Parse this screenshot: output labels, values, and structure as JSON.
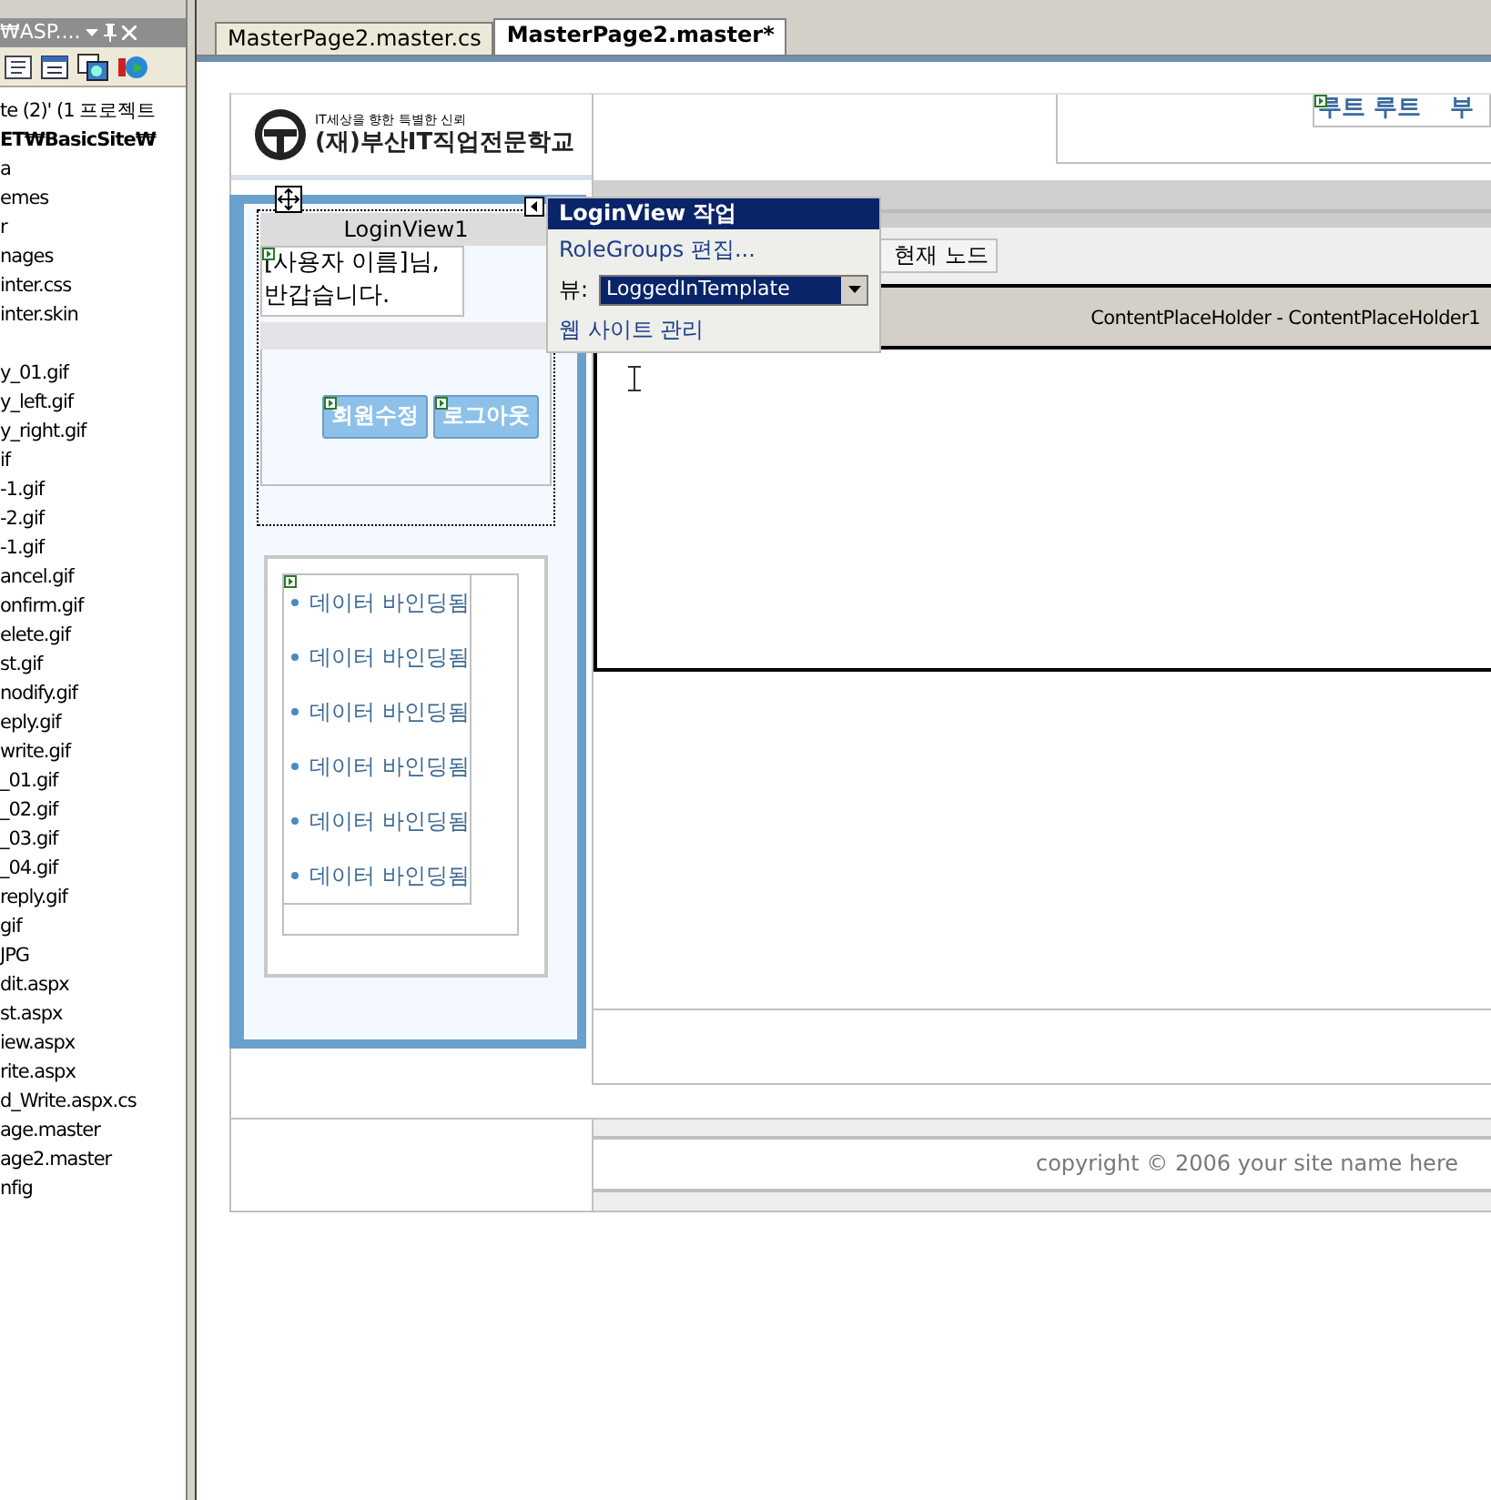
{
  "explorer": {
    "title": "₩ASP....",
    "items": [
      {
        "kind": "solution",
        "label": "te (2)' (1 프로젝트"
      },
      {
        "kind": "project",
        "label": "ET₩BasicSite₩"
      },
      {
        "kind": "item",
        "label": "a"
      },
      {
        "kind": "item",
        "label": "emes"
      },
      {
        "kind": "item",
        "label": "r"
      },
      {
        "kind": "item",
        "label": "nages"
      },
      {
        "kind": "item",
        "label": "inter.css"
      },
      {
        "kind": "item",
        "label": "inter.skin"
      },
      {
        "kind": "blank"
      },
      {
        "kind": "item",
        "label": "y_01.gif"
      },
      {
        "kind": "item",
        "label": "y_left.gif"
      },
      {
        "kind": "item",
        "label": "y_right.gif"
      },
      {
        "kind": "item",
        "label": "if"
      },
      {
        "kind": "item",
        "label": "-1.gif"
      },
      {
        "kind": "item",
        "label": "-2.gif"
      },
      {
        "kind": "item",
        "label": "-1.gif"
      },
      {
        "kind": "item",
        "label": "ancel.gif"
      },
      {
        "kind": "item",
        "label": "onfirm.gif"
      },
      {
        "kind": "item",
        "label": "elete.gif"
      },
      {
        "kind": "item",
        "label": "st.gif"
      },
      {
        "kind": "item",
        "label": "nodify.gif"
      },
      {
        "kind": "item",
        "label": "eply.gif"
      },
      {
        "kind": "item",
        "label": "write.gif"
      },
      {
        "kind": "item",
        "label": "_01.gif"
      },
      {
        "kind": "item",
        "label": "_02.gif"
      },
      {
        "kind": "item",
        "label": "_03.gif"
      },
      {
        "kind": "item",
        "label": "_04.gif"
      },
      {
        "kind": "item",
        "label": "reply.gif"
      },
      {
        "kind": "item",
        "label": "gif"
      },
      {
        "kind": "item",
        "label": "JPG"
      },
      {
        "kind": "item",
        "label": "dit.aspx"
      },
      {
        "kind": "item",
        "label": "st.aspx"
      },
      {
        "kind": "item",
        "label": "iew.aspx"
      },
      {
        "kind": "item",
        "label": "rite.aspx"
      },
      {
        "kind": "item",
        "label": "d_Write.aspx.cs"
      },
      {
        "kind": "item",
        "label": "age.master"
      },
      {
        "kind": "item",
        "label": "age2.master"
      },
      {
        "kind": "item",
        "label": "nfig"
      }
    ]
  },
  "tabs": [
    {
      "label": "MasterPage2.master.cs",
      "selected": false
    },
    {
      "label": "MasterPage2.master*",
      "selected": true
    }
  ],
  "header": {
    "slogan": "IT세상을 향한 특별한 신뢰",
    "school": "(재)부산IT직업전문학교",
    "breadcrumb": [
      "루트 루트",
      "부"
    ]
  },
  "menu_button": "현재 노드",
  "login_view": {
    "title": "LoginView1",
    "greeting": "[사용자 이름]님, 반갑습니다.",
    "buttons": [
      "회원수정",
      "로그아웃"
    ]
  },
  "smart_tag": {
    "title": "LoginView 작업",
    "edit_link": "RoleGroups 편집...",
    "view_label": "뷰:",
    "view_value": "LoggedInTemplate",
    "admin_link": "웹 사이트 관리"
  },
  "content_placeholder": {
    "label": "ContentPlaceHolder - ContentPlaceHolder1"
  },
  "data_list": [
    "데이터 바인딩됨",
    "데이터 바인딩됨",
    "데이터 바인딩됨",
    "데이터 바인딩됨",
    "데이터 바인딩됨",
    "데이터 바인딩됨"
  ],
  "footer": {
    "copyright": "copyright © 2006 your site name here"
  }
}
